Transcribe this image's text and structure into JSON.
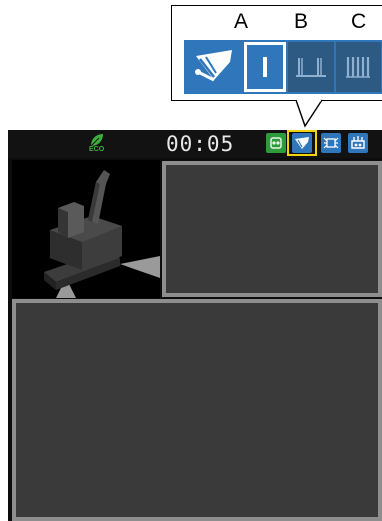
{
  "callout": {
    "columns": [
      "A",
      "B",
      "C"
    ],
    "modes": [
      {
        "icon": "wiper-icon"
      },
      {
        "icon": "wiper-mode-continuous-icon"
      },
      {
        "icon": "wiper-mode-intermittent-icon"
      },
      {
        "icon": "wiper-mode-off-icon"
      }
    ]
  },
  "status_bar": {
    "eco_label": "ECO",
    "clock": "00:05",
    "icons": [
      "engine-warning-icon",
      "wiper-icon",
      "washer-icon",
      "washer-fluid-icon"
    ]
  },
  "colors": {
    "strip_blue": "#2f77ba",
    "highlight_yellow": "#f2d20c",
    "panel_gray": "#3a3a3a",
    "panel_border": "#8e8e8e",
    "eco_green": "#3fae3f"
  }
}
